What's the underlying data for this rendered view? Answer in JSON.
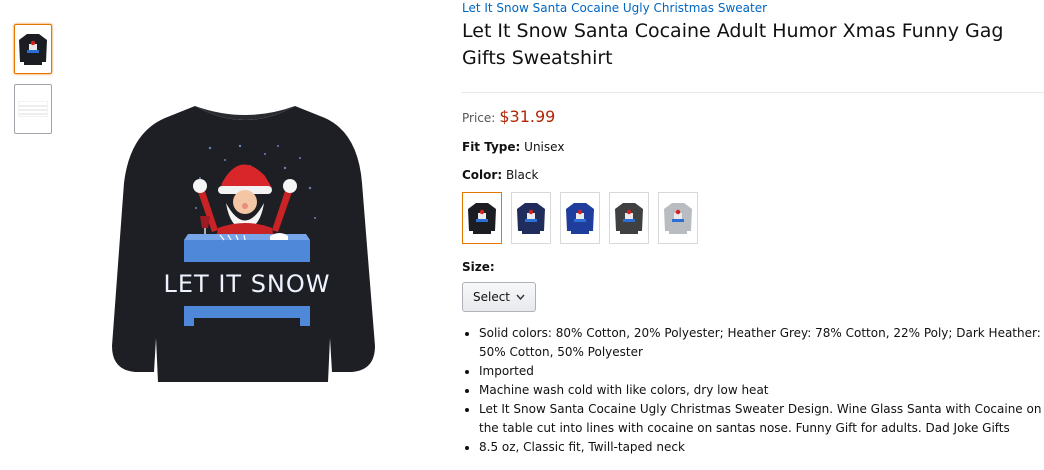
{
  "product": {
    "brand": "Let It Snow Santa Cocaine Ugly Christmas Sweater",
    "title": "Let It Snow Santa Cocaine Adult Humor Xmas Funny Gag Gifts Sweatshirt",
    "price_label": "Price:",
    "price": "$31.99",
    "fit_label": "Fit Type:",
    "fit_value": "Unisex",
    "color_label": "Color:",
    "color_value": "Black",
    "size_label": "Size:",
    "size_select": "Select",
    "main_image_text": "LET IT SNOW"
  },
  "swatches": [
    {
      "name": "black",
      "color": "#1c1d22"
    },
    {
      "name": "navy",
      "color": "#1f2c5c"
    },
    {
      "name": "royal",
      "color": "#1f3d9c"
    },
    {
      "name": "dark-heather",
      "color": "#3e4042"
    },
    {
      "name": "heather-grey",
      "color": "#b9bcc0"
    }
  ],
  "bullets": [
    "Solid colors: 80% Cotton, 20% Polyester; Heather Grey: 78% Cotton, 22% Poly; Dark Heather: 50% Cotton, 50% Polyester",
    "Imported",
    "Machine wash cold with like colors, dry low heat",
    "Let It Snow Santa Cocaine Ugly Christmas Sweater Design. Wine Glass Santa with Cocaine on the table cut into lines with cocaine on santas nose. Funny Gift for adults. Dad Joke Gifts",
    "8.5 oz, Classic fit, Twill-taped neck"
  ],
  "colors": {
    "link": "#0066c0",
    "price": "#b12704",
    "selected_border": "#e77600"
  }
}
